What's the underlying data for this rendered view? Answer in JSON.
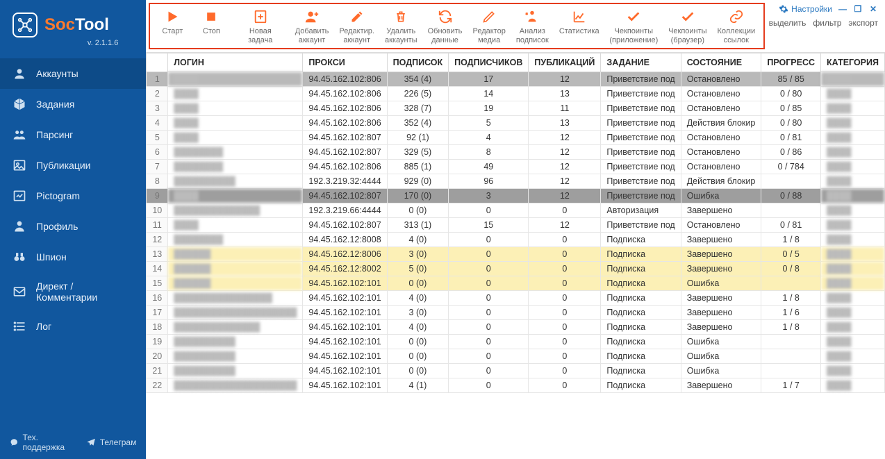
{
  "brand": {
    "soc": "Soc",
    "tool": "Tool",
    "version": "v. 2.1.1.6"
  },
  "sidebar": {
    "items": [
      {
        "label": "Аккаунты",
        "icon": "user-icon"
      },
      {
        "label": "Задания",
        "icon": "cube-icon"
      },
      {
        "label": "Парсинг",
        "icon": "people-icon"
      },
      {
        "label": "Публикации",
        "icon": "image-icon"
      },
      {
        "label": "Pictogram",
        "icon": "pictogram-icon"
      },
      {
        "label": "Профиль",
        "icon": "profile-icon"
      },
      {
        "label": "Шпион",
        "icon": "binoculars-icon"
      },
      {
        "label": "Директ / Комментарии",
        "icon": "mail-icon"
      },
      {
        "label": "Лог",
        "icon": "list-icon"
      }
    ]
  },
  "footer": {
    "support": "Тех. поддержка",
    "telegram": "Телеграм"
  },
  "window": {
    "settings": "Настройки"
  },
  "links": {
    "select": "выделить",
    "filter": "фильтр",
    "export": "экспорт"
  },
  "toolbar": {
    "items": [
      {
        "label": "Старт",
        "icon": "play-icon"
      },
      {
        "label": "Стоп",
        "icon": "stop-icon"
      },
      {
        "label": "Новая задача",
        "icon": "new-task-icon"
      },
      {
        "label": "Добавить\nаккаунт",
        "icon": "add-user-icon"
      },
      {
        "label": "Редактир.\nаккаунт",
        "icon": "edit-icon"
      },
      {
        "label": "Удалить\nаккаунты",
        "icon": "delete-icon"
      },
      {
        "label": "Обновить\nданные",
        "icon": "refresh-icon"
      },
      {
        "label": "Редактор\nмедиа",
        "icon": "pencil-icon"
      },
      {
        "label": "Анализ\nподписок",
        "icon": "analyze-icon"
      },
      {
        "label": "Статистика",
        "icon": "stats-icon"
      },
      {
        "label": "Чекпоинты\n(приложение)",
        "icon": "check-icon"
      },
      {
        "label": "Чекпоинты\n(браузер)",
        "icon": "check-icon"
      },
      {
        "label": "Коллекции\nссылок",
        "icon": "link-icon"
      }
    ]
  },
  "columns": [
    "ЛОГИН",
    "ПРОКСИ",
    "ПОДПИСОК",
    "ПОДПИСЧИКОВ",
    "ПУБЛИКАЦИЙ",
    "ЗАДАНИЕ",
    "СОСТОЯНИЕ",
    "ПРОГРЕСС",
    "КАТЕГОРИЯ"
  ],
  "rows": [
    {
      "n": 1,
      "cls": "sel",
      "login": "████",
      "proxy": "94.45.162.102:806",
      "sub": "354 (4)",
      "foll": "17",
      "pub": "12",
      "task": "Приветствие под",
      "state": "Остановлено",
      "prog": "85 / 85",
      "cat": "████"
    },
    {
      "n": 2,
      "cls": "",
      "login": "████",
      "proxy": "94.45.162.102:806",
      "sub": "226 (5)",
      "foll": "14",
      "pub": "13",
      "task": "Приветствие под",
      "state": "Остановлено",
      "prog": "0 / 80",
      "cat": "████"
    },
    {
      "n": 3,
      "cls": "",
      "login": "████",
      "proxy": "94.45.162.102:806",
      "sub": "328 (7)",
      "foll": "19",
      "pub": "11",
      "task": "Приветствие под",
      "state": "Остановлено",
      "prog": "0 / 85",
      "cat": "████"
    },
    {
      "n": 4,
      "cls": "",
      "login": "████",
      "proxy": "94.45.162.102:806",
      "sub": "352 (4)",
      "foll": "5",
      "pub": "13",
      "task": "Приветствие под",
      "state": "Действия блокир",
      "prog": "0 / 80",
      "cat": "████"
    },
    {
      "n": 5,
      "cls": "",
      "login": "████",
      "proxy": "94.45.162.102:807",
      "sub": "92 (1)",
      "foll": "4",
      "pub": "12",
      "task": "Приветствие под",
      "state": "Остановлено",
      "prog": "0 / 81",
      "cat": "████"
    },
    {
      "n": 6,
      "cls": "",
      "login": "████████",
      "proxy": "94.45.162.102:807",
      "sub": "329 (5)",
      "foll": "8",
      "pub": "12",
      "task": "Приветствие под",
      "state": "Остановлено",
      "prog": "0 / 86",
      "cat": "████"
    },
    {
      "n": 7,
      "cls": "",
      "login": "████████",
      "proxy": "94.45.162.102:806",
      "sub": "885 (1)",
      "foll": "49",
      "pub": "12",
      "task": "Приветствие под",
      "state": "Остановлено",
      "prog": "0 / 784",
      "cat": "████"
    },
    {
      "n": 8,
      "cls": "",
      "login": "██████████",
      "proxy": "192.3.219.32:4444",
      "sub": "929 (0)",
      "foll": "96",
      "pub": "12",
      "task": "Приветствие под",
      "state": "Действия блокир",
      "prog": "",
      "cat": "████"
    },
    {
      "n": 9,
      "cls": "err",
      "login": "████",
      "proxy": "94.45.162.102:807",
      "sub": "170 (0)",
      "foll": "3",
      "pub": "12",
      "task": "Приветствие под",
      "state": "Ошибка",
      "prog": "0 / 88",
      "cat": "████"
    },
    {
      "n": 10,
      "cls": "",
      "login": "██████████████",
      "proxy": "192.3.219.66:4444",
      "sub": "0 (0)",
      "foll": "0",
      "pub": "0",
      "task": "Авторизация",
      "state": "Завершено",
      "prog": "",
      "cat": "████"
    },
    {
      "n": 11,
      "cls": "",
      "login": "████",
      "proxy": "94.45.162.102:807",
      "sub": "313 (1)",
      "foll": "15",
      "pub": "12",
      "task": "Приветствие под",
      "state": "Остановлено",
      "prog": "0 / 81",
      "cat": "████"
    },
    {
      "n": 12,
      "cls": "",
      "login": "████████",
      "proxy": "94.45.162.12:8008",
      "sub": "4 (0)",
      "foll": "0",
      "pub": "0",
      "task": "Подписка",
      "state": "Завершено",
      "prog": "1 / 8",
      "cat": "████"
    },
    {
      "n": 13,
      "cls": "hl",
      "login": "██████",
      "proxy": "94.45.162.12:8006",
      "sub": "3 (0)",
      "foll": "0",
      "pub": "0",
      "task": "Подписка",
      "state": "Завершено",
      "prog": "0 / 5",
      "cat": "████"
    },
    {
      "n": 14,
      "cls": "hl",
      "login": "██████",
      "proxy": "94.45.162.12:8002",
      "sub": "5 (0)",
      "foll": "0",
      "pub": "0",
      "task": "Подписка",
      "state": "Завершено",
      "prog": "0 / 8",
      "cat": "████"
    },
    {
      "n": 15,
      "cls": "hl",
      "login": "██████",
      "proxy": "94.45.162.102:101",
      "sub": "0 (0)",
      "foll": "0",
      "pub": "0",
      "task": "Подписка",
      "state": "Ошибка",
      "prog": "",
      "cat": "████"
    },
    {
      "n": 16,
      "cls": "",
      "login": "████████████████",
      "proxy": "94.45.162.102:101",
      "sub": "4 (0)",
      "foll": "0",
      "pub": "0",
      "task": "Подписка",
      "state": "Завершено",
      "prog": "1 / 8",
      "cat": "████"
    },
    {
      "n": 17,
      "cls": "",
      "login": "████████████████████",
      "proxy": "94.45.162.102:101",
      "sub": "3 (0)",
      "foll": "0",
      "pub": "0",
      "task": "Подписка",
      "state": "Завершено",
      "prog": "1 / 6",
      "cat": "████"
    },
    {
      "n": 18,
      "cls": "",
      "login": "██████████████",
      "proxy": "94.45.162.102:101",
      "sub": "4 (0)",
      "foll": "0",
      "pub": "0",
      "task": "Подписка",
      "state": "Завершено",
      "prog": "1 / 8",
      "cat": "████"
    },
    {
      "n": 19,
      "cls": "",
      "login": "██████████",
      "proxy": "94.45.162.102:101",
      "sub": "0 (0)",
      "foll": "0",
      "pub": "0",
      "task": "Подписка",
      "state": "Ошибка",
      "prog": "",
      "cat": "████"
    },
    {
      "n": 20,
      "cls": "",
      "login": "██████████",
      "proxy": "94.45.162.102:101",
      "sub": "0 (0)",
      "foll": "0",
      "pub": "0",
      "task": "Подписка",
      "state": "Ошибка",
      "prog": "",
      "cat": "████"
    },
    {
      "n": 21,
      "cls": "",
      "login": "██████████",
      "proxy": "94.45.162.102:101",
      "sub": "0 (0)",
      "foll": "0",
      "pub": "0",
      "task": "Подписка",
      "state": "Ошибка",
      "prog": "",
      "cat": "████"
    },
    {
      "n": 22,
      "cls": "",
      "login": "████████████████████",
      "proxy": "94.45.162.102:101",
      "sub": "4 (1)",
      "foll": "0",
      "pub": "0",
      "task": "Подписка",
      "state": "Завершено",
      "prog": "1 / 7",
      "cat": "████"
    }
  ]
}
